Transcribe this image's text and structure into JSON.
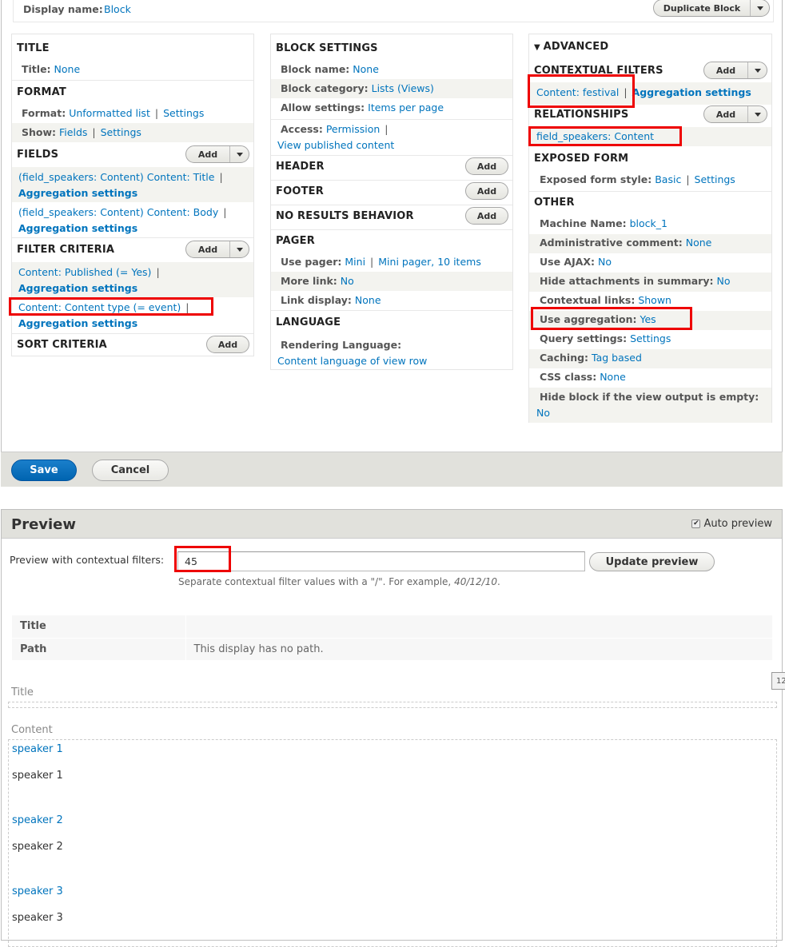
{
  "display": {
    "name_label": "Display name:",
    "name_value": "Block",
    "duplicate_button": "Duplicate Block"
  },
  "col1": {
    "title": {
      "heading": "TITLE",
      "key": "Title:",
      "value": "None"
    },
    "format": {
      "heading": "FORMAT",
      "format_key": "Format:",
      "format_value": "Unformatted list",
      "format_settings": "Settings",
      "show_key": "Show:",
      "show_value": "Fields",
      "show_settings": "Settings"
    },
    "fields": {
      "heading": "FIELDS",
      "add": "Add",
      "items": [
        {
          "label": "(field_speakers: Content) Content: Title",
          "agg": "Aggregation settings"
        },
        {
          "label": "(field_speakers: Content) Content: Body",
          "agg": "Aggregation settings"
        }
      ]
    },
    "filters": {
      "heading": "FILTER CRITERIA",
      "add": "Add",
      "items": [
        {
          "label": "Content: Published (= Yes)",
          "agg": "Aggregation settings"
        },
        {
          "label": "Content: Content type (= event)",
          "agg": "Aggregation settings"
        }
      ]
    },
    "sort": {
      "heading": "SORT CRITERIA",
      "add": "Add"
    }
  },
  "col2": {
    "block": {
      "heading": "BLOCK SETTINGS",
      "name_key": "Block name:",
      "name_value": "None",
      "category_key": "Block category:",
      "category_value": "Lists (Views)",
      "allow_key": "Allow settings:",
      "allow_value": "Items per page",
      "access_key": "Access:",
      "access_value": "Permission",
      "access_detail": "View published content"
    },
    "header": {
      "heading": "HEADER",
      "add": "Add"
    },
    "footer": {
      "heading": "FOOTER",
      "add": "Add"
    },
    "no_results": {
      "heading": "NO RESULTS BEHAVIOR",
      "add": "Add"
    },
    "pager": {
      "heading": "PAGER",
      "use_key": "Use pager:",
      "use_value": "Mini",
      "use_detail": "Mini pager, 10 items",
      "more_key": "More link:",
      "more_value": "No",
      "link_key": "Link display:",
      "link_value": "None"
    },
    "language": {
      "heading": "LANGUAGE",
      "key": "Rendering Language:",
      "value": "Content language of view row"
    }
  },
  "col3": {
    "advanced": "ADVANCED",
    "contextual": {
      "heading": "CONTEXTUAL FILTERS",
      "add": "Add",
      "item": "Content: festival",
      "agg": "Aggregation settings"
    },
    "relationships": {
      "heading": "RELATIONSHIPS",
      "add": "Add",
      "item": "field_speakers: Content"
    },
    "exposed": {
      "heading": "EXPOSED FORM",
      "key": "Exposed form style:",
      "value": "Basic",
      "settings": "Settings"
    },
    "other": {
      "heading": "OTHER",
      "rows": [
        {
          "key": "Machine Name:",
          "value": "block_1"
        },
        {
          "key": "Administrative comment:",
          "value": "None"
        },
        {
          "key": "Use AJAX:",
          "value": "No"
        },
        {
          "key": "Hide attachments in summary:",
          "value": "No"
        },
        {
          "key": "Contextual links:",
          "value": "Shown"
        },
        {
          "key": "Use aggregation:",
          "value": "Yes"
        },
        {
          "key": "Query settings:",
          "value": "Settings"
        },
        {
          "key": "Caching:",
          "value": "Tag based"
        },
        {
          "key": "CSS class:",
          "value": "None"
        },
        {
          "key": "Hide block if the view output is empty:",
          "value": "No"
        }
      ]
    }
  },
  "actions": {
    "save": "Save",
    "cancel": "Cancel"
  },
  "preview": {
    "title": "Preview",
    "auto_preview": "Auto preview",
    "auto_preview_checked": true,
    "ctx_label": "Preview with contextual filters:",
    "ctx_value": "45",
    "update_button": "Update preview",
    "help_text": "Separate contextual filter values with a \"/\". For example, ",
    "help_example": "40/12/10",
    "help_end": ".",
    "table": [
      {
        "key": "Title",
        "value": ""
      },
      {
        "key": "Path",
        "value": "This display has no path."
      }
    ],
    "title_area_label": "Title",
    "content_area_label": "Content",
    "results": [
      {
        "title": "speaker 1",
        "body": "speaker 1"
      },
      {
        "title": "speaker 2",
        "body": "speaker 2"
      },
      {
        "title": "speaker 3",
        "body": "speaker 3"
      }
    ],
    "side_tab": "12"
  }
}
